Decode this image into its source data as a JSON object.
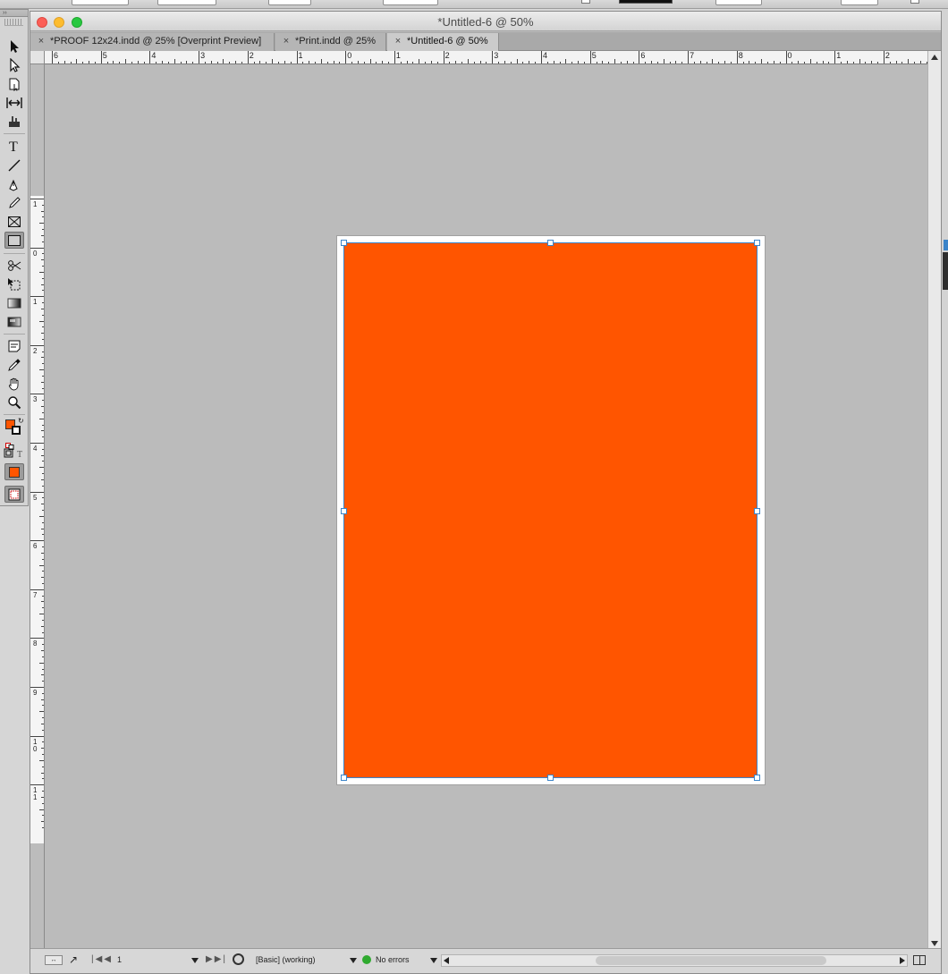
{
  "window": {
    "title": "*Untitled-6 @ 50%",
    "tabs": [
      {
        "label": "*PROOF 12x24.indd @ 25% [Overprint Preview]",
        "active": false
      },
      {
        "label": "*Print.indd @ 25%",
        "active": false
      },
      {
        "label": "*Untitled-6 @ 50%",
        "active": true
      }
    ]
  },
  "rulers": {
    "horizontal_labels": [
      "6",
      "5",
      "4",
      "3",
      "2",
      "1",
      "0",
      "1",
      "2",
      "3",
      "4",
      "5",
      "6",
      "7",
      "8",
      "0",
      "1",
      "2",
      "3"
    ],
    "vertical_labels": [
      "1",
      "0",
      "1",
      "2",
      "3",
      "4",
      "5",
      "6",
      "7",
      "8",
      "9",
      "10",
      "11"
    ]
  },
  "frame": {
    "fill_color": "#ff5500"
  },
  "status": {
    "page_number": "1",
    "preflight_profile": "[Basic] (working)",
    "errors_label": "No errors",
    "errors_color": "#2faa2f"
  },
  "colors": {
    "fill_swatch": "#ff5500",
    "selection": "#3b84c9"
  },
  "tools": [
    {
      "icon": "selection-tool-icon"
    },
    {
      "icon": "direct-selection-tool-icon"
    },
    {
      "icon": "page-tool-icon"
    },
    {
      "icon": "gap-tool-icon"
    },
    {
      "icon": "content-collector-tool-icon"
    },
    {
      "icon": "type-tool-icon"
    },
    {
      "icon": "line-tool-icon"
    },
    {
      "icon": "pen-tool-icon"
    },
    {
      "icon": "pencil-tool-icon"
    },
    {
      "icon": "rectangle-frame-tool-icon"
    },
    {
      "icon": "rectangle-tool-icon"
    },
    {
      "icon": "scissors-tool-icon"
    },
    {
      "icon": "free-transform-tool-icon"
    },
    {
      "icon": "gradient-swatch-tool-icon"
    },
    {
      "icon": "gradient-feather-tool-icon"
    },
    {
      "icon": "note-tool-icon"
    },
    {
      "icon": "eyedropper-tool-icon"
    },
    {
      "icon": "hand-tool-icon"
    },
    {
      "icon": "zoom-tool-icon"
    }
  ]
}
